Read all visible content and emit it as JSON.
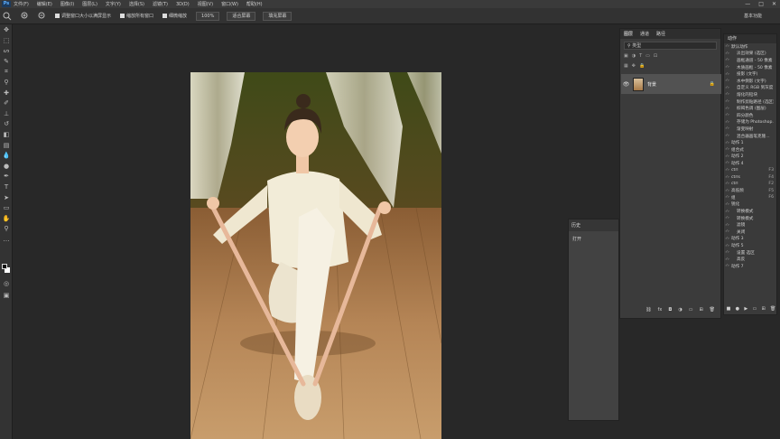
{
  "menubar": {
    "logo": "Ps",
    "items": [
      "文件(F)",
      "编辑(E)",
      "图像(I)",
      "图层(L)",
      "文字(Y)",
      "选择(S)",
      "滤镜(T)",
      "3D(D)",
      "视图(V)",
      "窗口(W)",
      "帮助(H)"
    ],
    "win_controls": [
      "—",
      "□",
      "✕"
    ]
  },
  "optbar": {
    "zoom_in_icon": "zoom-in",
    "zoom_out_icon": "zoom-out",
    "resize_windows_label": "调整窗口大小以满屏显示",
    "zoom_all_windows_label": "缩放所有窗口",
    "scrubby_zoom_label": "细微缩放",
    "zoom_percent": "100%",
    "fit_screen_label": "适合屏幕",
    "fill_screen_label": "填充屏幕",
    "workspace_label": "基本功能"
  },
  "layers_panel": {
    "tabs": [
      "图层",
      "通道",
      "路径"
    ],
    "kind_filter": "类型",
    "layer_name": "背景"
  },
  "history_panel": {
    "tab": "历史",
    "entry": "打开"
  },
  "actions_panel": {
    "tab": "动作",
    "items": [
      {
        "name": "默认动作",
        "key": "",
        "sub": false
      },
      {
        "name": "淡出效果 (选区)",
        "key": "",
        "sub": true
      },
      {
        "name": "画框通道 - 50 像素",
        "key": "",
        "sub": true
      },
      {
        "name": "木质画框 - 50 像素",
        "key": "",
        "sub": true
      },
      {
        "name": "投影 (文字)",
        "key": "",
        "sub": true
      },
      {
        "name": "水中倒影 (文字)",
        "key": "",
        "sub": true
      },
      {
        "name": "自定义 RGB 到灰度",
        "key": "",
        "sub": true
      },
      {
        "name": "熔化的铅块",
        "key": "",
        "sub": true
      },
      {
        "name": "制作剪贴路径 (选区)",
        "key": "",
        "sub": true
      },
      {
        "name": "棕褐色调 (图层)",
        "key": "",
        "sub": true
      },
      {
        "name": "四分颜色",
        "key": "",
        "sub": true
      },
      {
        "name": "存储为 Photoshop...",
        "key": "",
        "sub": true
      },
      {
        "name": "渐变映射",
        "key": "",
        "sub": true
      },
      {
        "name": "混合器画笔克隆...",
        "key": "",
        "sub": true
      },
      {
        "name": "动作 1",
        "key": "",
        "sub": false
      },
      {
        "name": "组合式",
        "key": "",
        "sub": false
      },
      {
        "name": "动作 2",
        "key": "",
        "sub": false
      },
      {
        "name": "动作 4",
        "key": "",
        "sub": false
      },
      {
        "name": "ctrl",
        "key": "F3",
        "sub": false
      },
      {
        "name": "ctrls",
        "key": "F4",
        "sub": false
      },
      {
        "name": "ctrl",
        "key": "F2",
        "sub": false
      },
      {
        "name": "高低频",
        "key": "F5",
        "sub": false
      },
      {
        "name": "组",
        "key": "F6",
        "sub": false
      },
      {
        "name": "锐化",
        "key": "",
        "sub": false
      },
      {
        "name": "转换模式",
        "key": "",
        "sub": true
      },
      {
        "name": "转换模式",
        "key": "",
        "sub": true
      },
      {
        "name": "滤镜",
        "key": "",
        "sub": true
      },
      {
        "name": "关闭",
        "key": "",
        "sub": true
      },
      {
        "name": "动作 3",
        "key": "",
        "sub": false
      },
      {
        "name": "动作 5",
        "key": "",
        "sub": false
      },
      {
        "name": "设置 选区",
        "key": "",
        "sub": true
      },
      {
        "name": "高反",
        "key": "",
        "sub": true
      },
      {
        "name": "动作 7",
        "key": "",
        "sub": false
      }
    ]
  },
  "colors": {
    "app_bg": "#282828",
    "panel_bg": "#3b3b3b",
    "selected_layer": "#525252"
  }
}
